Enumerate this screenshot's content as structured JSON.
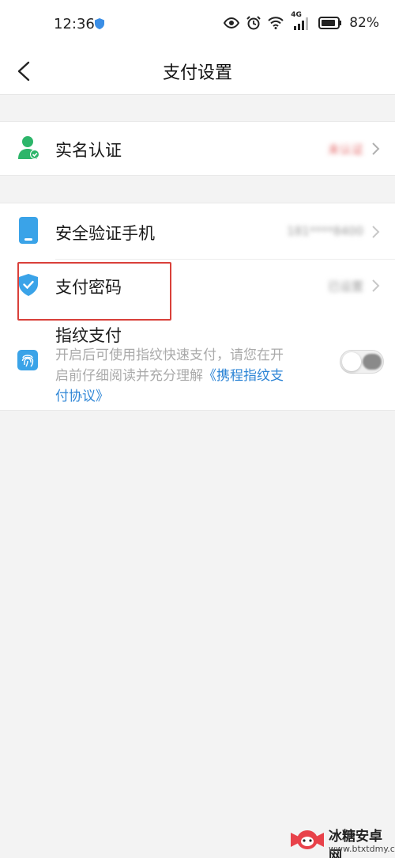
{
  "status_bar": {
    "time": "12:36",
    "network": "4G",
    "battery": "82%"
  },
  "nav": {
    "title": "支付设置"
  },
  "sections": {
    "identity": {
      "label": "实名认证",
      "value": "未认证"
    },
    "phone": {
      "label": "安全验证手机",
      "value": "181****8400"
    },
    "password": {
      "label": "支付密码",
      "value": "已设置"
    },
    "fingerprint": {
      "label": "指纹支付",
      "desc_line1": "开启后可使用指纹快速支付，请您在开",
      "desc_line2_plain": "启前仔细阅读并充分理解",
      "desc_line2_link": "《携程指纹支",
      "desc_line3_link": "付协议》",
      "enabled": false
    }
  },
  "colors": {
    "accent_blue": "#2f86d6",
    "icon_blue": "#3aa3e8",
    "person_green": "#2db56a",
    "highlight_red": "#d9403a"
  },
  "watermark": {
    "name": "冰糖安卓网",
    "url": "www.btxtdmy.com"
  }
}
